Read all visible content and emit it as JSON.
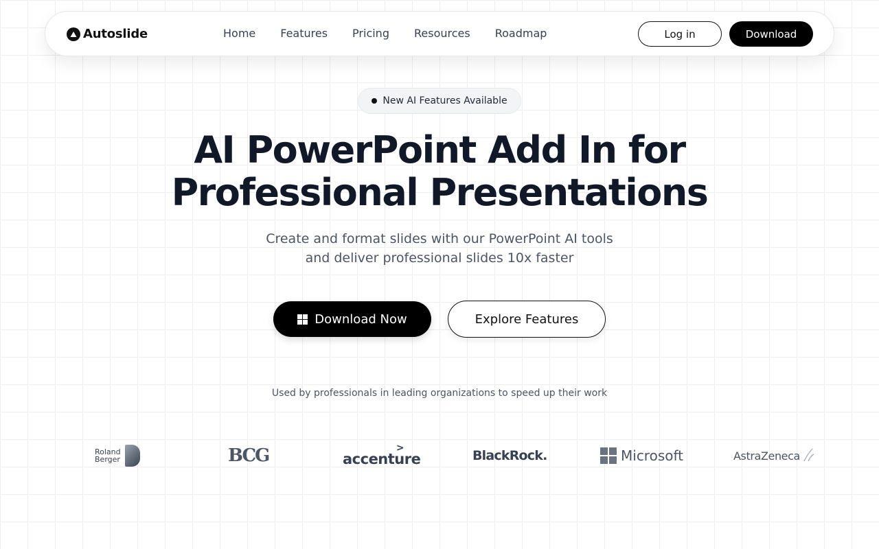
{
  "brand": {
    "name": "Autoslide",
    "logo_icon": "triangle-icon"
  },
  "nav": {
    "links": [
      "Home",
      "Features",
      "Pricing",
      "Resources",
      "Roadmap"
    ],
    "login_label": "Log in",
    "download_label": "Download"
  },
  "badge": {
    "text": "New AI Features Available"
  },
  "hero": {
    "title_line1": "AI PowerPoint Add In for",
    "title_line2": "Professional Presentations",
    "subtitle_line1": "Create and format slides with our PowerPoint AI tools",
    "subtitle_line2": "and deliver professional slides 10x faster",
    "cta_primary": "Download Now",
    "cta_primary_icon": "windows-icon",
    "cta_secondary": "Explore Features"
  },
  "social_proof": {
    "caption": "Used by professionals in leading organizations to speed up their work",
    "logos": {
      "roland_line1": "Roland",
      "roland_line2": "Berger",
      "bcg": "BCG",
      "accenture": "accenture",
      "accenture_mark": ">",
      "blackrock": "BlackRock.",
      "microsoft": "Microsoft",
      "astrazeneca": "AstraZeneca"
    }
  },
  "colors": {
    "text_primary": "#111827",
    "text_secondary": "#4b5563",
    "button_dark": "#000000",
    "grid_line": "#eeeeee"
  }
}
